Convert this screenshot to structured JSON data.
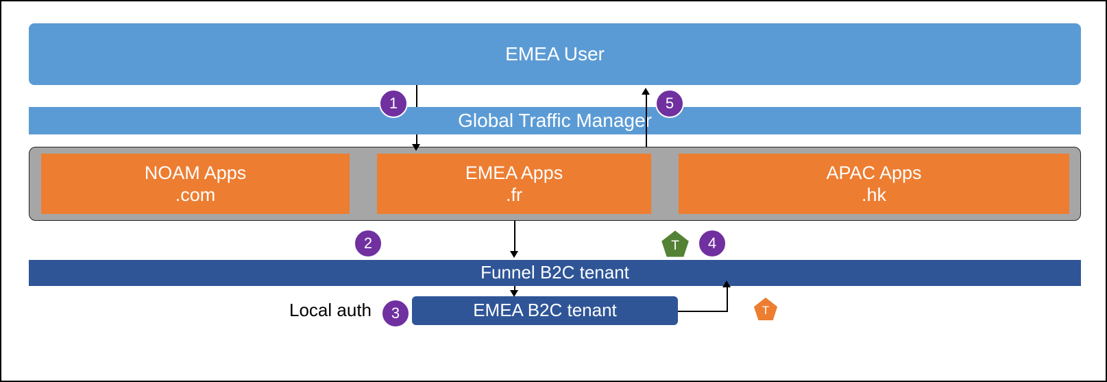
{
  "boxes": {
    "emea_user": "EMEA User",
    "gtm": "Global Traffic Manager",
    "noam_apps": "NOAM Apps\n.com",
    "emea_apps": "EMEA Apps\n.fr",
    "apac_apps": "APAC Apps\n.hk",
    "funnel": "Funnel B2C tenant",
    "emea_b2c": "EMEA B2C tenant",
    "local_auth": "Local auth"
  },
  "steps": {
    "s1": "1",
    "s2": "2",
    "s3": "3",
    "s4": "4",
    "s5": "5"
  },
  "tokens": {
    "green": "T",
    "orange": "T"
  },
  "colors": {
    "light_blue": "#5B9BD5",
    "dark_blue": "#2F5597",
    "orange": "#ED7D31",
    "gray": "#A6A6A6",
    "purple": "#7030A0",
    "green": "#548235",
    "token_orange": "#ED7D31"
  }
}
